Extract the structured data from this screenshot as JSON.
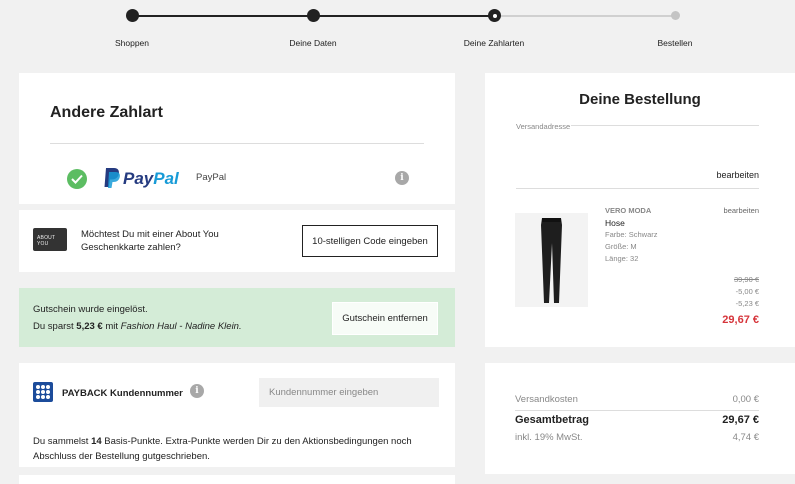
{
  "stepper": {
    "steps": [
      {
        "label": "Shoppen",
        "state": "done"
      },
      {
        "label": "Deine Daten",
        "state": "done"
      },
      {
        "label": "Deine Zahlarten",
        "state": "current"
      },
      {
        "label": "Bestellen",
        "state": "todo"
      }
    ]
  },
  "payment": {
    "title": "Andere Zahlart",
    "method_logo_pay": "Pay",
    "method_logo_pal": "Pal",
    "method_name": "PayPal",
    "info_glyph": "i"
  },
  "giftcard": {
    "image_text": "ABOUT YOU",
    "text": "Möchtest Du mit einer About You Geschenkkarte zahlen?",
    "button": "10-stelligen Code eingeben"
  },
  "voucher": {
    "line1": "Gutschein wurde eingelöst.",
    "line2_prefix": "Du sparst ",
    "line2_amount": "5,23 €",
    "line2_mid": " mit ",
    "line2_code": "Fashion Haul - Nadine Klein.",
    "button": "Gutschein entfernen"
  },
  "payback": {
    "label": "PAYBACK Kundennummer",
    "info_glyph": "i",
    "input_placeholder": "Kundennummer eingeben",
    "text_prefix": "Du sammelst ",
    "points": "14",
    "text_suffix": " Basis-Punkte. Extra-Punkte werden Dir zu den Aktionsbedingungen noch Abschluss der Bestellung gutgeschrieben."
  },
  "order": {
    "title": "Deine Bestellung",
    "address_label": "Versandadresse",
    "edit_link": "bearbeiten",
    "item": {
      "brand": "VERO MODA",
      "name": "Hose",
      "color": "Farbe: Schwarz",
      "size": "Größe: M",
      "length": "Länge: 32",
      "edit": "bearbeiten",
      "price_original": "39,90 €",
      "discount1": "-5,00 €",
      "discount2": "-5,23 €",
      "price_final": "29,67 €"
    }
  },
  "totals": {
    "shipping_label": "Versandkosten",
    "shipping_value": "0,00 €",
    "total_label": "Gesamtbetrag",
    "total_value": "29,67 €",
    "vat_label": "inkl. 19% MwSt.",
    "vat_value": "4,74 €"
  },
  "colors": {
    "accent_green": "#5cbd62",
    "voucher_bg": "#d4ecd7",
    "price_red": "#d6353b",
    "paypal_dark": "#253b80",
    "paypal_light": "#179bd7"
  }
}
